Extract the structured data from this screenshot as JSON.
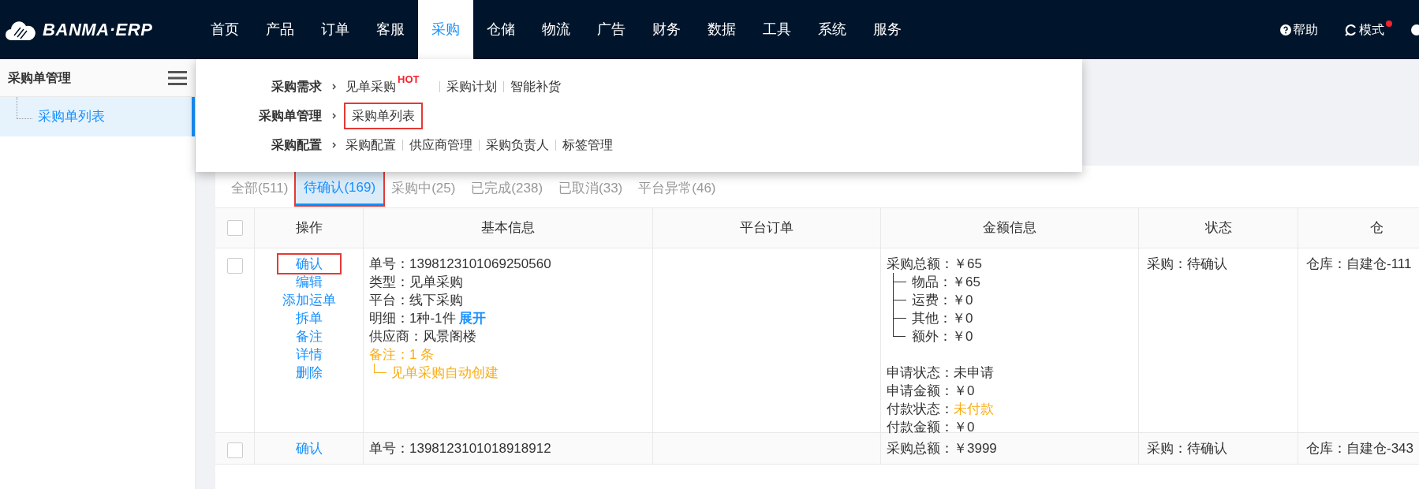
{
  "brand": {
    "name": "BANMA·ERP"
  },
  "nav": [
    {
      "label": "首页",
      "selected": false
    },
    {
      "label": "产品",
      "selected": false
    },
    {
      "label": "订单",
      "selected": false
    },
    {
      "label": "客服",
      "selected": false
    },
    {
      "label": "采购",
      "selected": true
    },
    {
      "label": "仓储",
      "selected": false
    },
    {
      "label": "物流",
      "selected": false
    },
    {
      "label": "广告",
      "selected": false
    },
    {
      "label": "财务",
      "selected": false
    },
    {
      "label": "数据",
      "selected": false
    },
    {
      "label": "工具",
      "selected": false
    },
    {
      "label": "系统",
      "selected": false
    },
    {
      "label": "服务",
      "selected": false
    }
  ],
  "top_actions": [
    {
      "kind": "help",
      "label": "帮助",
      "notify": false
    },
    {
      "kind": "mode",
      "label": "模式",
      "notify": true
    }
  ],
  "sidebar": {
    "title": "采购单管理",
    "items": [
      {
        "label": "采购单列表",
        "selected": true
      }
    ]
  },
  "dropdown": [
    {
      "group": "采购需求",
      "items": [
        {
          "label": "见单采购",
          "badge": "HOT",
          "highlighted": false
        },
        {
          "label": "采购计划",
          "highlighted": false
        },
        {
          "label": "智能补货",
          "highlighted": false
        }
      ]
    },
    {
      "group": "采购单管理",
      "items": [
        {
          "label": "采购单列表",
          "highlighted": true
        }
      ]
    },
    {
      "group": "采购配置",
      "items": [
        {
          "label": "采购配置",
          "highlighted": false
        },
        {
          "label": "供应商管理",
          "highlighted": false
        },
        {
          "label": "采购负责人",
          "highlighted": false
        },
        {
          "label": "标签管理",
          "highlighted": false
        }
      ]
    }
  ],
  "tabs": [
    {
      "label": "全部(511)",
      "selected": false,
      "highlighted": false
    },
    {
      "label": "待确认(169)",
      "selected": true,
      "highlighted": true
    },
    {
      "label": "采购中(25)",
      "selected": false,
      "highlighted": false
    },
    {
      "label": "已完成(238)",
      "selected": false,
      "highlighted": false
    },
    {
      "label": "已取消(33)",
      "selected": false,
      "highlighted": false
    },
    {
      "label": "平台异常(46)",
      "selected": false,
      "highlighted": false
    }
  ],
  "table": {
    "header_checked": false,
    "columns": [
      "操作",
      "基本信息",
      "平台订单",
      "金额信息",
      "状态",
      "仓"
    ],
    "rows": [
      {
        "checked": false,
        "actions": [
          {
            "label": "确认",
            "highlighted": true
          },
          {
            "label": "编辑",
            "highlighted": false
          },
          {
            "label": "添加运单",
            "highlighted": false
          },
          {
            "label": "拆单",
            "highlighted": false
          },
          {
            "label": "备注",
            "highlighted": false
          },
          {
            "label": "详情",
            "highlighted": false
          },
          {
            "label": "删除",
            "highlighted": false
          }
        ],
        "basic": [
          {
            "kind": "plain",
            "text": "单号：1398123101069250560"
          },
          {
            "kind": "plain",
            "text": "类型：见单采购"
          },
          {
            "kind": "plain",
            "text": "平台：线下采购"
          },
          {
            "kind": "detail",
            "text": "明细：1种-1件",
            "link": "展开"
          },
          {
            "kind": "plain",
            "text": "供应商：风景阁楼"
          },
          {
            "kind": "note",
            "text": "备注：1 条"
          },
          {
            "kind": "subnote",
            "text": "见单采购自动创建"
          }
        ],
        "amount": [
          {
            "kind": "total",
            "text": "采购总额：￥65"
          },
          {
            "kind": "branch",
            "text": "物品：￥65"
          },
          {
            "kind": "branch",
            "text": "运费：￥0"
          },
          {
            "kind": "branch",
            "text": "其他：￥0"
          },
          {
            "kind": "last",
            "text": "额外：￥0"
          },
          {
            "kind": "gap"
          },
          {
            "kind": "plain",
            "text": "申请状态：未申请"
          },
          {
            "kind": "plain",
            "text": "申请金额：￥0"
          },
          {
            "kind": "warn",
            "text": "付款状态：",
            "value": "未付款"
          },
          {
            "kind": "plain",
            "text": "付款金额：￥0"
          }
        ],
        "status": "采购：待确认",
        "warehouse": "仓库：自建仓-111"
      },
      {
        "checked": false,
        "actions": [
          {
            "label": "确认",
            "highlighted": false
          }
        ],
        "basic": [
          {
            "kind": "plain",
            "text": "单号：1398123101018918912"
          }
        ],
        "amount": [
          {
            "kind": "total",
            "text": "采购总额：￥3999"
          }
        ],
        "status": "采购：待确认",
        "warehouse": "仓库：自建仓-343"
      }
    ]
  }
}
